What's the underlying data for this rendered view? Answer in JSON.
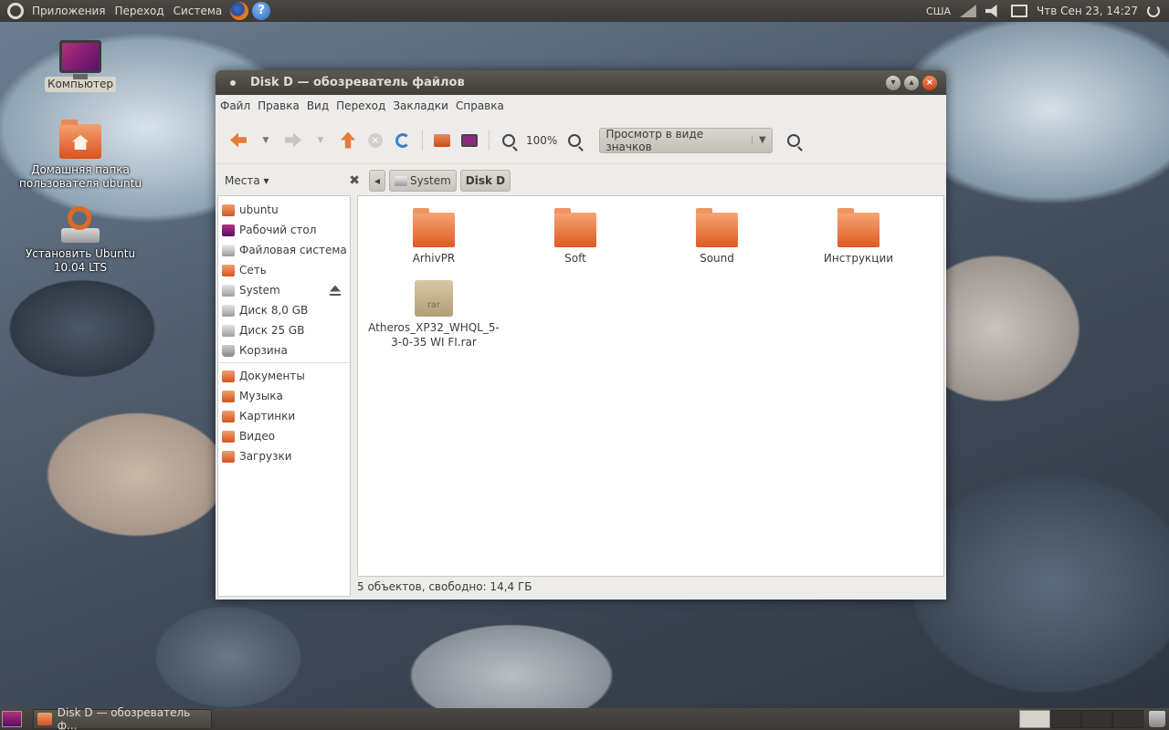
{
  "top_panel": {
    "menus": [
      "Приложения",
      "Переход",
      "Система"
    ],
    "keyboard": "США",
    "clock": "Чтв Сен 23, 14:27"
  },
  "desktop": {
    "icons": [
      {
        "label": "Компьютер"
      },
      {
        "label": "Домашняя папка пользователя ubuntu"
      },
      {
        "label": "Установить Ubuntu 10.04 LTS"
      }
    ]
  },
  "window": {
    "title": "Disk D — обозреватель файлов",
    "menu": [
      "Файл",
      "Правка",
      "Вид",
      "Переход",
      "Закладки",
      "Справка"
    ],
    "toolbar": {
      "zoom": "100%",
      "view_mode": "Просмотр в виде значков"
    },
    "places_label": "Места",
    "breadcrumbs": [
      "System",
      "Disk D"
    ],
    "sidebar": {
      "places": [
        "ubuntu",
        "Рабочий стол",
        "Файловая система",
        "Сеть",
        "System",
        "Диск 8,0 GB",
        "Диск 25 GB",
        "Корзина"
      ],
      "bookmarks": [
        "Документы",
        "Музыка",
        "Картинки",
        "Видео",
        "Загрузки"
      ]
    },
    "files": [
      {
        "name": "ArhivPR",
        "type": "folder"
      },
      {
        "name": "Soft",
        "type": "folder"
      },
      {
        "name": "Sound",
        "type": "folder"
      },
      {
        "name": "Инструкции",
        "type": "folder"
      },
      {
        "name": "Atheros_XP32_WHQL_5-3-0-35 WI FI.rar",
        "type": "archive",
        "badge": "rar"
      }
    ],
    "status": "5 объектов, свободно: 14,4 ГБ"
  },
  "taskbar": {
    "task_label": "Disk D — обозреватель ф..."
  },
  "colors": {
    "panel": "#3a3935",
    "accent_orange": "#e05a22",
    "window_bg": "#edeceb"
  }
}
